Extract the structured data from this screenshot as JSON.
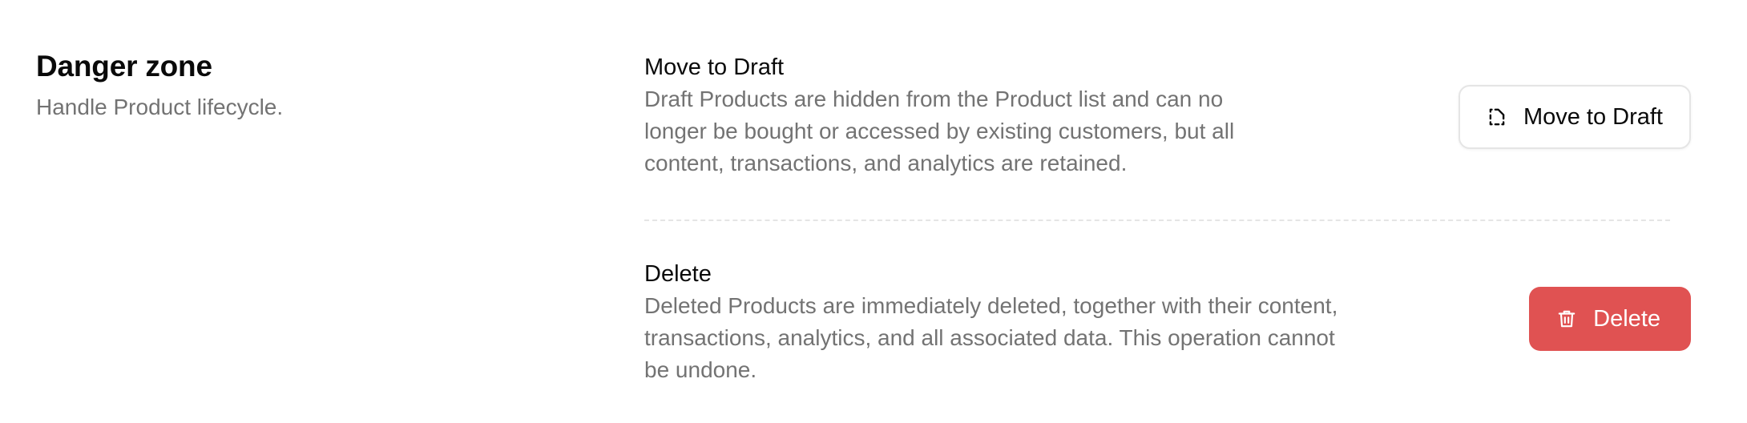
{
  "section": {
    "title": "Danger zone",
    "subtitle": "Handle Product lifecycle."
  },
  "draft": {
    "title": "Move to Draft",
    "description": "Draft Products are hidden from the Product list and can no longer be bought or accessed by existing customers, but all content, transactions, and analytics are retained.",
    "button_label": "Move to Draft",
    "icon": "file-dashed-icon"
  },
  "delete": {
    "title": "Delete",
    "description": "Deleted Products are immediately deleted, together with their content, transactions, analytics, and all associated data. This operation cannot be undone.",
    "button_label": "Delete",
    "icon": "trash-icon"
  },
  "colors": {
    "danger": "#e05252",
    "muted_text": "#737373",
    "border": "#e5e5e5"
  }
}
